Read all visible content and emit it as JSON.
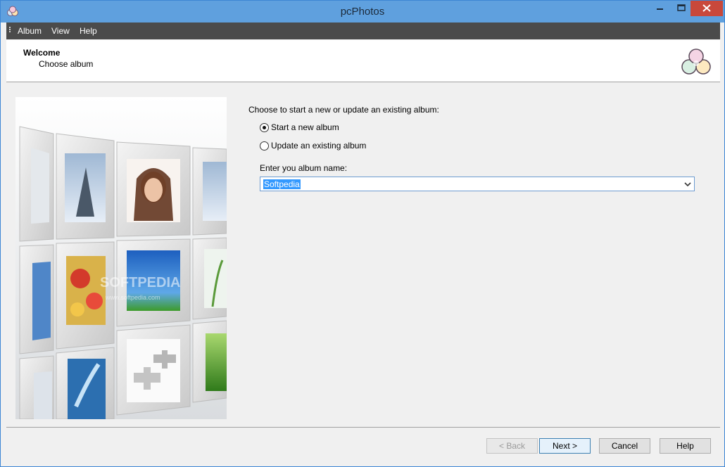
{
  "window": {
    "title": "pcPhotos"
  },
  "menu": {
    "items": [
      "Album",
      "View",
      "Help"
    ]
  },
  "header": {
    "title": "Welcome",
    "subtitle": "Choose album"
  },
  "content": {
    "prompt": "Choose to start a new or update an existing album:",
    "options": [
      {
        "label": "Start a new album",
        "selected": true
      },
      {
        "label": "Update an existing album",
        "selected": false
      }
    ],
    "name_label": "Enter you album name:",
    "name_value": "Softpedia"
  },
  "side_image": {
    "watermark": "SOFTPEDIA",
    "watermark_url": "www.softpedia.com"
  },
  "buttons": {
    "back": "< Back",
    "next": "Next >",
    "cancel": "Cancel",
    "help": "Help"
  },
  "colors": {
    "titlebar": "#5fa0de",
    "menubar": "#4b4b4b",
    "close": "#c9483b",
    "selection": "#3399ff"
  }
}
